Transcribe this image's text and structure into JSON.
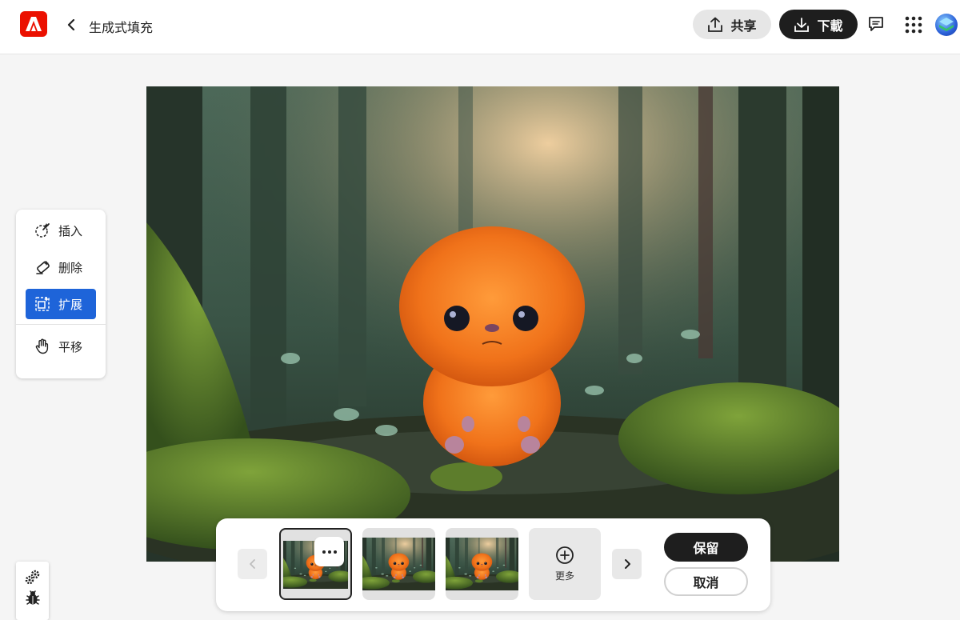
{
  "header": {
    "logo_icon": "adobe-logo-icon",
    "back_icon": "chevron-left-icon",
    "title": "生成式填充",
    "share_label": "共享",
    "share_icon": "upload-icon",
    "download_label": "下載",
    "download_icon": "download-icon",
    "comment_icon": "comment-icon",
    "apps_icon": "grid-icon",
    "brand_color": "#eb1000"
  },
  "canvas": {
    "description_icon": "forest-creature-image"
  },
  "tools": [
    {
      "label": "插入",
      "icon": "insert-brush-icon",
      "active": false
    },
    {
      "label": "删除",
      "icon": "eraser-icon",
      "active": false
    },
    {
      "label": "扩展",
      "icon": "expand-icon",
      "active": true
    },
    {
      "label": "平移",
      "icon": "hand-icon",
      "active": false
    }
  ],
  "accent_color": "#1e64d9",
  "variations": {
    "prev_icon": "chevron-left-icon",
    "next_icon": "chevron-right-icon",
    "more_label": "更多",
    "more_icon": "plus-circle-icon",
    "keep_label": "保留",
    "cancel_label": "取消"
  },
  "debug": {
    "gear_icon": "gears-icon",
    "bug_icon": "bug-icon"
  }
}
